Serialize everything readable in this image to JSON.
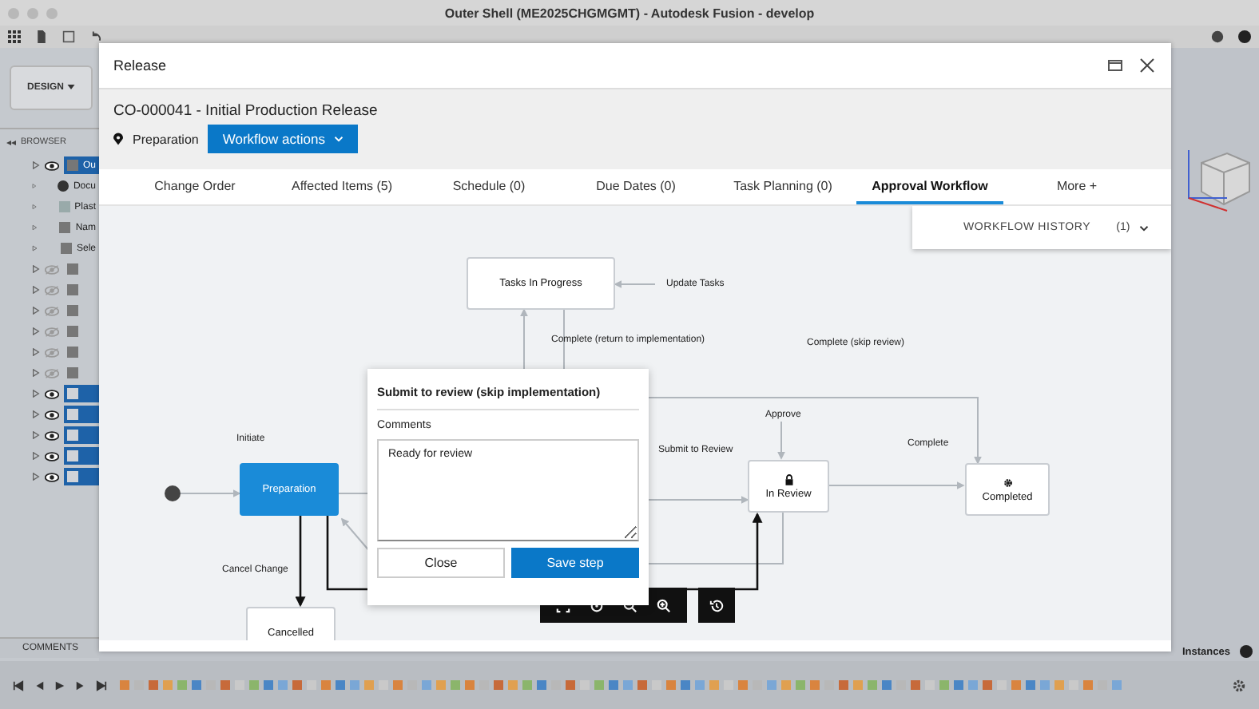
{
  "app": {
    "title": "Outer Shell (ME2025CHGMGMT) - Autodesk Fusion - develop",
    "workspace": "DESIGN",
    "browser_label": "BROWSER",
    "browser_items": [
      {
        "label": "Ou",
        "kind": "component",
        "visible": true,
        "selected": true
      },
      {
        "label": "Docu",
        "kind": "settings",
        "selected": false
      },
      {
        "label": "Plast",
        "kind": "material",
        "selected": false
      },
      {
        "label": "Nam",
        "kind": "folder",
        "selected": false
      },
      {
        "label": "Sele",
        "kind": "folder",
        "selected": false
      },
      {
        "kind": "folder",
        "visible": false,
        "selected": false
      },
      {
        "kind": "folder",
        "visible": false,
        "selected": false
      },
      {
        "kind": "folder",
        "visible": false,
        "selected": false
      },
      {
        "kind": "folder",
        "visible": false,
        "selected": false
      },
      {
        "kind": "folder",
        "visible": false,
        "selected": false
      },
      {
        "kind": "folder",
        "visible": false,
        "selected": false
      },
      {
        "kind": "body",
        "visible": true,
        "selected": true
      },
      {
        "kind": "body",
        "visible": true,
        "selected": true
      },
      {
        "kind": "body",
        "visible": true,
        "selected": true
      },
      {
        "kind": "body",
        "visible": true,
        "selected": true
      },
      {
        "kind": "body",
        "visible": true,
        "selected": true
      }
    ],
    "comments_label": "COMMENTS",
    "status": "Instances"
  },
  "dialog": {
    "title": "Release",
    "record": "CO-000041 - Initial Production Release",
    "state": "Preparation",
    "actions_button": "Workflow actions",
    "tabs": [
      {
        "label": "Change Order",
        "selected": false
      },
      {
        "label": "Affected Items (5)",
        "selected": false
      },
      {
        "label": "Schedule (0)",
        "selected": false
      },
      {
        "label": "Due Dates (0)",
        "selected": false
      },
      {
        "label": "Task Planning (0)",
        "selected": false
      },
      {
        "label": "Approval Workflow",
        "selected": true
      },
      {
        "label": "More +",
        "selected": false
      }
    ],
    "history": {
      "label": "WORKFLOW HISTORY",
      "count": "(1)"
    },
    "diagram": {
      "nodes": [
        {
          "kind": "start"
        },
        {
          "label": "Preparation",
          "kind": "state",
          "selected": true
        },
        {
          "label": "Tasks In Progress",
          "kind": "state",
          "selected": false
        },
        {
          "label": "In Review",
          "kind": "review",
          "selected": false
        },
        {
          "label": "Completed",
          "kind": "final",
          "selected": false
        },
        {
          "label": "Cancelled",
          "kind": "state",
          "selected": false
        }
      ],
      "edge_labels": [
        "Initiate",
        "Update Tasks",
        "Complete (return to implementation)",
        "Complete (skip review)",
        "Approve",
        "Submit to Review",
        "Complete",
        "Cancel Change"
      ]
    },
    "popup": {
      "title": "Submit to review (skip implementation)",
      "comments_label": "Comments",
      "comment": "Ready for review",
      "buttons": [
        "Close",
        "Save step"
      ]
    }
  }
}
